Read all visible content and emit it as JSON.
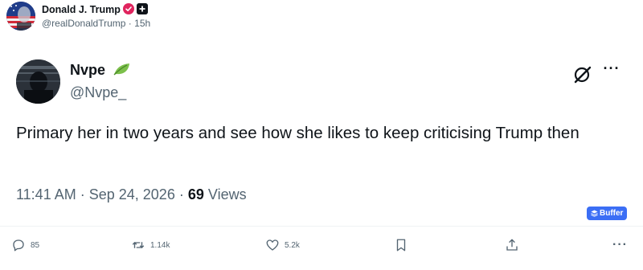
{
  "post": {
    "author_name": "Donald J. Trump",
    "author_handle": "@realDonaldTrump",
    "separator": "·",
    "time_ago": "15h"
  },
  "quoted": {
    "name": "Nvpe",
    "handle": "@Nvpe_",
    "text": "Primary her in two years and see how she likes to keep criticising Trump then",
    "time": "11:41 AM",
    "date": "Sep 24, 2026",
    "views_count": "69",
    "views_label": "Views",
    "more_icon": "more-horizontal-icon",
    "grok_icon": "grok-icon"
  },
  "buffer": {
    "label": "Buffer"
  },
  "actions": {
    "replies": "85",
    "reposts": "1.14k",
    "likes": "5.2k"
  },
  "colors": {
    "text_primary": "#0f1419",
    "text_secondary": "#536471",
    "buffer_blue": "#3b6ef5",
    "verified_pink": "#e0245e"
  }
}
